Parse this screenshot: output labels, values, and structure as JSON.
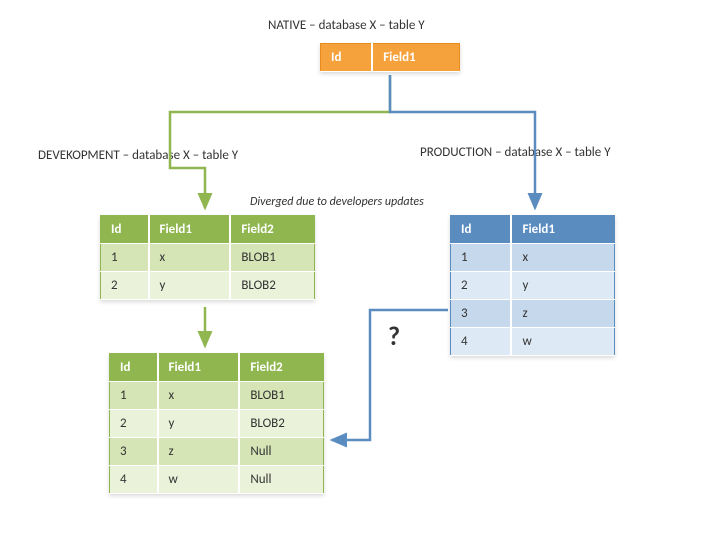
{
  "labels": {
    "native_title": "NATIVE – database X – table Y",
    "dev_title": "DEVEKOPMENT – database X – table Y",
    "prod_title": "PRODUCTION – database X – table Y",
    "diverged": "Diverged due to developers updates",
    "question": "?"
  },
  "native_table": {
    "headers": [
      "Id",
      "Field1"
    ]
  },
  "dev_table": {
    "headers": [
      "Id",
      "Field1",
      "Field2"
    ],
    "rows": [
      [
        "1",
        "x",
        "BLOB1"
      ],
      [
        "2",
        "y",
        "BLOB2"
      ]
    ]
  },
  "prod_table": {
    "headers": [
      "Id",
      "Field1"
    ],
    "rows": [
      [
        "1",
        "x"
      ],
      [
        "2",
        "y"
      ],
      [
        "3",
        "z"
      ],
      [
        "4",
        "w"
      ]
    ]
  },
  "merged_table": {
    "headers": [
      "Id",
      "Field1",
      "Field2"
    ],
    "rows": [
      [
        "1",
        "x",
        "BLOB1"
      ],
      [
        "2",
        "y",
        "BLOB2"
      ],
      [
        "3",
        "z",
        "Null"
      ],
      [
        "4",
        "w",
        "Null"
      ]
    ]
  },
  "chart_data": {
    "type": "table",
    "title": "Database table divergence and merge flow",
    "flow": [
      "NATIVE → DEVEKOPMENT",
      "NATIVE → PRODUCTION",
      "DEVEKOPMENT → MERGED",
      "PRODUCTION → MERGED (?)"
    ],
    "tables": {
      "native": {
        "headers": [
          "Id",
          "Field1"
        ],
        "rows": []
      },
      "development": {
        "headers": [
          "Id",
          "Field1",
          "Field2"
        ],
        "rows": [
          [
            "1",
            "x",
            "BLOB1"
          ],
          [
            "2",
            "y",
            "BLOB2"
          ]
        ]
      },
      "production": {
        "headers": [
          "Id",
          "Field1"
        ],
        "rows": [
          [
            "1",
            "x"
          ],
          [
            "2",
            "y"
          ],
          [
            "3",
            "z"
          ],
          [
            "4",
            "w"
          ]
        ]
      },
      "merged": {
        "headers": [
          "Id",
          "Field1",
          "Field2"
        ],
        "rows": [
          [
            "1",
            "x",
            "BLOB1"
          ],
          [
            "2",
            "y",
            "BLOB2"
          ],
          [
            "3",
            "z",
            "Null"
          ],
          [
            "4",
            "w",
            "Null"
          ]
        ]
      }
    },
    "annotation": {
      "diverged_note": "Diverged due to developers updates",
      "merge_question": "?"
    }
  }
}
